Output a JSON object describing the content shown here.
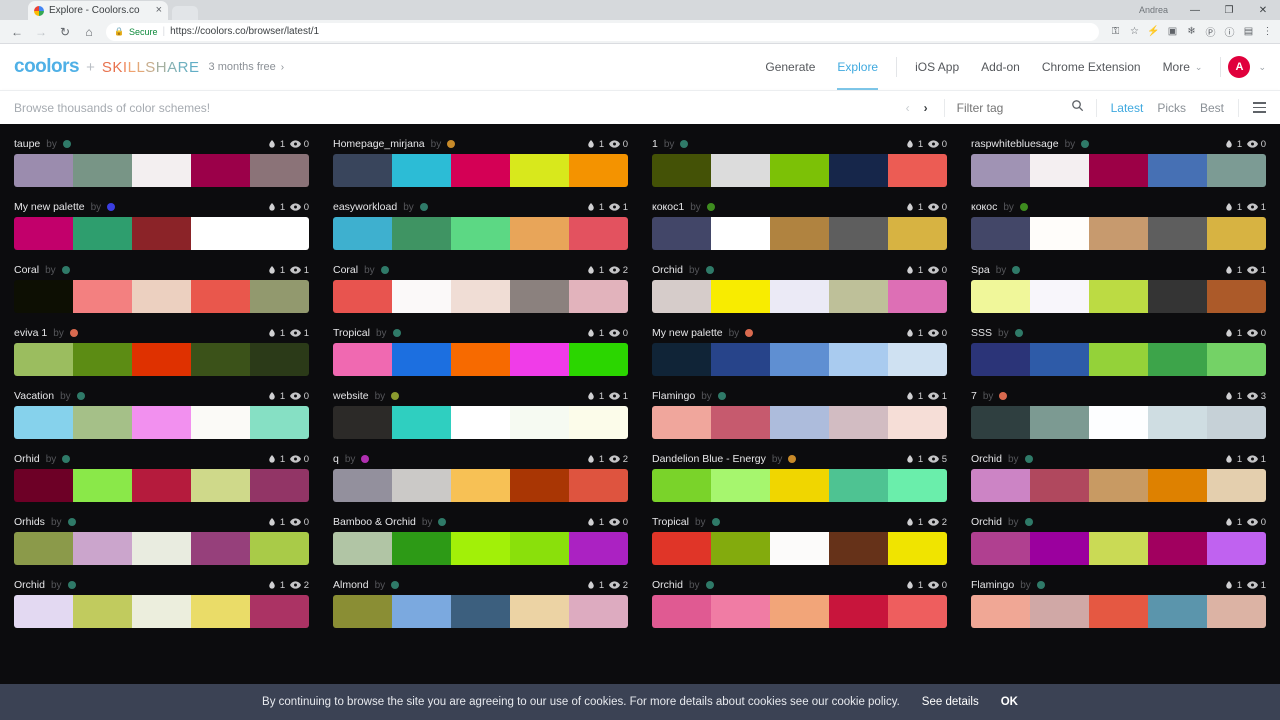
{
  "browser": {
    "tab": {
      "title": "Explore - Coolors.co",
      "favicon": "coolors-favicon",
      "close": "×"
    },
    "new_tab_label": "",
    "window": {
      "user": "Andrea",
      "minimize": "—",
      "maximize": "❐",
      "close": "✕"
    },
    "nav": {
      "back": "←",
      "forward": "→",
      "reload": "↻",
      "home": "⌂"
    },
    "omnibox": {
      "lock": "🔒",
      "secure_label": "Secure",
      "separator": "|",
      "url": "https://coolors.co/browser/latest/1"
    },
    "extensions": [
      {
        "name": "key-icon",
        "glyph": "⚿"
      },
      {
        "name": "bookmark-star-icon",
        "glyph": "☆"
      },
      {
        "name": "lightning-icon",
        "glyph": "⚡"
      },
      {
        "name": "pocket-icon",
        "glyph": "▣"
      },
      {
        "name": "snowflake-icon",
        "glyph": "❄"
      },
      {
        "name": "pinterest-icon",
        "glyph": "Ⓟ"
      },
      {
        "name": "info-icon",
        "glyph": "ⓘ"
      },
      {
        "name": "screenshot-icon",
        "glyph": "▤"
      },
      {
        "name": "chrome-menu-icon",
        "glyph": "⋮"
      }
    ]
  },
  "header": {
    "logo": "coolors",
    "plus": "+",
    "partner": "SKILLSHARE",
    "promo": "3 months free",
    "promo_arrow": "›",
    "nav_primary": [
      {
        "label": "Generate",
        "active": false
      },
      {
        "label": "Explore",
        "active": true
      }
    ],
    "nav_secondary": [
      {
        "label": "iOS App"
      },
      {
        "label": "Add-on"
      },
      {
        "label": "Chrome Extension"
      },
      {
        "label": "More"
      }
    ],
    "more_caret": "⌄",
    "avatar_letter": "A",
    "avatar_color": "#e0003c",
    "account_caret": "⌄"
  },
  "subheader": {
    "browse_text": "Browse thousands of color schemes!",
    "pager": {
      "prev": "‹",
      "next": "›"
    },
    "filter": {
      "placeholder": "Filter tag",
      "value": "",
      "search_icon": "search-icon"
    },
    "sorts": [
      {
        "label": "Latest",
        "active": true
      },
      {
        "label": "Picks",
        "active": false
      },
      {
        "label": "Best",
        "active": false
      }
    ],
    "menu_icon": "hamburger-menu-icon"
  },
  "cookie": {
    "message": "By continuing to browse the site you are agreeing to our use of cookies. For more details about cookies see our cookie policy.",
    "details_label": "See details",
    "ok_label": "OK"
  },
  "grid": {
    "columns": [
      {
        "cards": [
          {
            "title": "taupe",
            "by": "by",
            "dot": "#2f7a68",
            "likes": "1",
            "views": "0",
            "colors": [
              "#9b8cae",
              "#789586",
              "#f3eff0",
              "#9b0049",
              "#8b7378"
            ]
          },
          {
            "title": "My new palette",
            "by": "by",
            "dot": "#3b3ee0",
            "likes": "1",
            "views": "0",
            "colors": [
              "#c2006b",
              "#2e9e6e",
              "#8b2328",
              "#ffffff",
              "#ffffff"
            ]
          },
          {
            "title": "Coral",
            "by": "by",
            "dot": "#2f7a68",
            "likes": "1",
            "views": "1",
            "colors": [
              "#0d0f03",
              "#f38080",
              "#ecd0c0",
              "#e9574c",
              "#92996e"
            ]
          },
          {
            "title": "eviva 1",
            "by": "by",
            "dot": "#d96a4f",
            "likes": "1",
            "views": "1",
            "colors": [
              "#9bbd5f",
              "#5c8c14",
              "#df3100",
              "#3b5219",
              "#2b3a18"
            ]
          },
          {
            "title": "Vacation",
            "by": "by",
            "dot": "#2f7a68",
            "likes": "1",
            "views": "0",
            "colors": [
              "#86d2ec",
              "#a5c088",
              "#f290ef",
              "#fbfaf7",
              "#86e0c4"
            ]
          },
          {
            "title": "Orhid",
            "by": "by",
            "dot": "#2f7a68",
            "likes": "1",
            "views": "0",
            "colors": [
              "#6d0026",
              "#8ae849",
              "#b51b3d",
              "#cfd98a",
              "#923566"
            ]
          },
          {
            "title": "Orhids",
            "by": "by",
            "dot": "#2f7a68",
            "likes": "1",
            "views": "0",
            "colors": [
              "#8b9a4a",
              "#cba5cc",
              "#e9ece0",
              "#96407b",
              "#a9cb48"
            ]
          },
          {
            "title": "Orchid",
            "by": "by",
            "dot": "#2f7a68",
            "likes": "1",
            "views": "2",
            "colors": [
              "#e3d9f2",
              "#c1cb5e",
              "#eceedd",
              "#eadc68",
              "#ab3364"
            ]
          }
        ]
      },
      {
        "cards": [
          {
            "title": "Homepage_mirjana",
            "by": "by",
            "dot": "#c88a29",
            "likes": "1",
            "views": "0",
            "colors": [
              "#39455c",
              "#2cbcd6",
              "#d40055",
              "#d8e81c",
              "#f49300"
            ]
          },
          {
            "title": "easyworkload",
            "by": "by",
            "dot": "#2f7a68",
            "likes": "1",
            "views": "1",
            "colors": [
              "#3eb0cf",
              "#3f9463",
              "#5cd884",
              "#e8a559",
              "#e3525f"
            ]
          },
          {
            "title": "Coral",
            "by": "by",
            "dot": "#2f7a68",
            "likes": "1",
            "views": "2",
            "colors": [
              "#e8544f",
              "#fbf9f9",
              "#f0ddd5",
              "#8b817e",
              "#e2b3bc"
            ]
          },
          {
            "title": "Tropical",
            "by": "by",
            "dot": "#2f7a68",
            "likes": "1",
            "views": "0",
            "colors": [
              "#f069b1",
              "#1c6fe0",
              "#f76a00",
              "#f03ce8",
              "#2bd600"
            ]
          },
          {
            "title": "website",
            "by": "by",
            "dot": "#8a9a2f",
            "likes": "1",
            "views": "1",
            "colors": [
              "#2c2a28",
              "#2fcfc0",
              "#ffffff",
              "#f6faf2",
              "#fcfcea"
            ]
          },
          {
            "title": "q",
            "by": "by",
            "dot": "#b02fb0",
            "likes": "1",
            "views": "2",
            "colors": [
              "#93909d",
              "#cbc9c7",
              "#f7c155",
              "#a93604",
              "#de543f"
            ]
          },
          {
            "title": "Bamboo & Orchid",
            "by": "by",
            "dot": "#2f7a68",
            "likes": "1",
            "views": "0",
            "colors": [
              "#b1c5a5",
              "#2d9a16",
              "#a2f008",
              "#8ae00b",
              "#ab22c2"
            ]
          },
          {
            "title": "Almond",
            "by": "by",
            "dot": "#2f7a68",
            "likes": "1",
            "views": "2",
            "colors": [
              "#8a8e34",
              "#7ba9df",
              "#3c5f7e",
              "#ecd3a4",
              "#ddabc0"
            ]
          }
        ]
      },
      {
        "cards": [
          {
            "title": "1",
            "by": "by",
            "dot": "#2f7a68",
            "likes": "1",
            "views": "0",
            "colors": [
              "#445206",
              "#dcdcdc",
              "#7cc106",
              "#16264a",
              "#ec5c54"
            ]
          },
          {
            "title": "кокос1",
            "by": "by",
            "dot": "#3e8c1f",
            "likes": "1",
            "views": "0",
            "colors": [
              "#424668",
              "#ffffff",
              "#b08340",
              "#5e5e5e",
              "#d7b342"
            ]
          },
          {
            "title": "Orchid",
            "by": "by",
            "dot": "#2f7a68",
            "likes": "1",
            "views": "0",
            "colors": [
              "#d6ccca",
              "#f8ec00",
              "#ebeaf6",
              "#bec099",
              "#dd6fb5"
            ]
          },
          {
            "title": "My new palette",
            "by": "by",
            "dot": "#d96a4f",
            "likes": "1",
            "views": "0",
            "colors": [
              "#102437",
              "#27448a",
              "#5f8fd2",
              "#a9cbef",
              "#cfe1f2"
            ]
          },
          {
            "title": "Flamingo",
            "by": "by",
            "dot": "#2f7a68",
            "likes": "1",
            "views": "1",
            "colors": [
              "#f0a69c",
              "#c65a6e",
              "#adbcdc",
              "#d2bcc2",
              "#f6ded7"
            ]
          },
          {
            "title": "Dandelion Blue - Energy",
            "by": "by",
            "dot": "#c88a29",
            "likes": "1",
            "views": "5",
            "colors": [
              "#7ad32a",
              "#a6f66e",
              "#f0d600",
              "#4ec392",
              "#6aeeab"
            ]
          },
          {
            "title": "Tropical",
            "by": "by",
            "dot": "#2f7a68",
            "likes": "1",
            "views": "2",
            "colors": [
              "#e03528",
              "#83ab0d",
              "#fcfbfa",
              "#663219",
              "#f0e400"
            ]
          },
          {
            "title": "Orchid",
            "by": "by",
            "dot": "#2f7a68",
            "likes": "1",
            "views": "0",
            "colors": [
              "#e05a92",
              "#f07ca4",
              "#f2a579",
              "#c8153c",
              "#ee5e5e"
            ]
          }
        ]
      },
      {
        "cards": [
          {
            "title": "raspwhitebluesage",
            "by": "by",
            "dot": "#2f7a68",
            "likes": "1",
            "views": "0",
            "colors": [
              "#a093b4",
              "#f4eff1",
              "#9c0046",
              "#4670b4",
              "#7c9b94"
            ]
          },
          {
            "title": "кокос",
            "by": "by",
            "dot": "#3e8c1f",
            "likes": "1",
            "views": "1",
            "colors": [
              "#434768",
              "#fffdfa",
              "#c79a6e",
              "#5e5e5e",
              "#d7b342"
            ]
          },
          {
            "title": "Spa",
            "by": "by",
            "dot": "#2f7a68",
            "likes": "1",
            "views": "1",
            "colors": [
              "#f0f79a",
              "#f8f6fb",
              "#bcdb43",
              "#343434",
              "#ac5a29"
            ]
          },
          {
            "title": "SSS",
            "by": "by",
            "dot": "#2f7a68",
            "likes": "1",
            "views": "0",
            "colors": [
              "#2b3478",
              "#2e5ba8",
              "#94d239",
              "#3da44a",
              "#74d266"
            ]
          },
          {
            "title": "7",
            "by": "by",
            "dot": "#d96a4f",
            "likes": "1",
            "views": "3",
            "colors": [
              "#2f3f40",
              "#7c9a92",
              "#fdfeff",
              "#cfdde2",
              "#c6d1d7"
            ]
          },
          {
            "title": "Orchid",
            "by": "by",
            "dot": "#2f7a68",
            "likes": "1",
            "views": "1",
            "colors": [
              "#cc84c5",
              "#b0485e",
              "#c89a63",
              "#de8100",
              "#e4cfae"
            ]
          },
          {
            "title": "Orchid",
            "by": "by",
            "dot": "#2f7a68",
            "likes": "1",
            "views": "0",
            "colors": [
              "#b04090",
              "#9b009e",
              "#cada55",
              "#a1005f",
              "#c062f0"
            ]
          },
          {
            "title": "Flamingo",
            "by": "by",
            "dot": "#2f7a68",
            "likes": "1",
            "views": "1",
            "colors": [
              "#f0a795",
              "#d0a8a6",
              "#e55842",
              "#5b95ac",
              "#dcb3a4"
            ]
          }
        ]
      }
    ]
  }
}
